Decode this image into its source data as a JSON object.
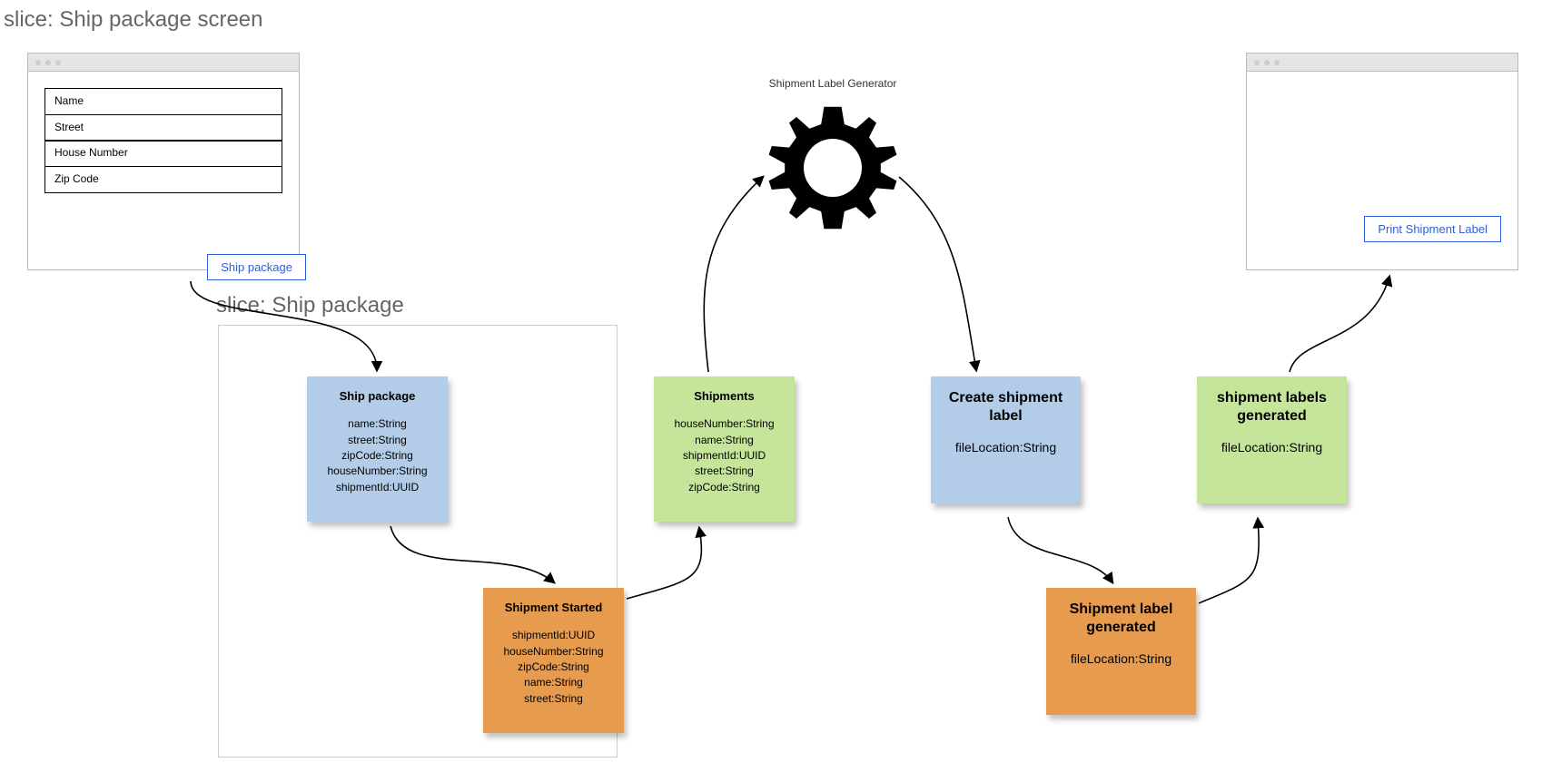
{
  "titles": {
    "slice_screen": "slice: Ship package screen",
    "slice_package": "slice: Ship package"
  },
  "gear_label": "Shipment Label Generator",
  "screen_form": {
    "fields": [
      "Name",
      "Street",
      "House Number",
      "Zip Code"
    ],
    "button": "Ship package"
  },
  "print_button": "Print Shipment Label",
  "notes": {
    "ship_package": {
      "title": "Ship package",
      "lines": [
        "name:String",
        "street:String",
        "zipCode:String",
        "houseNumber:String",
        "shipmentId:UUID"
      ]
    },
    "shipments": {
      "title": "Shipments",
      "lines": [
        "houseNumber:String",
        "name:String",
        "shipmentId:UUID",
        "street:String",
        "zipCode:String"
      ]
    },
    "create_label": {
      "title": "Create shipment label",
      "lines": [
        "fileLocation:String"
      ]
    },
    "labels_generated": {
      "title": "shipment labels generated",
      "lines": [
        "fileLocation:String"
      ]
    },
    "shipment_started": {
      "title": "Shipment Started",
      "lines": [
        "shipmentId:UUID",
        "houseNumber:String",
        "zipCode:String",
        "name:String",
        "street:String"
      ]
    },
    "label_generated": {
      "title": "Shipment label generated",
      "lines": [
        "fileLocation:String"
      ]
    }
  }
}
